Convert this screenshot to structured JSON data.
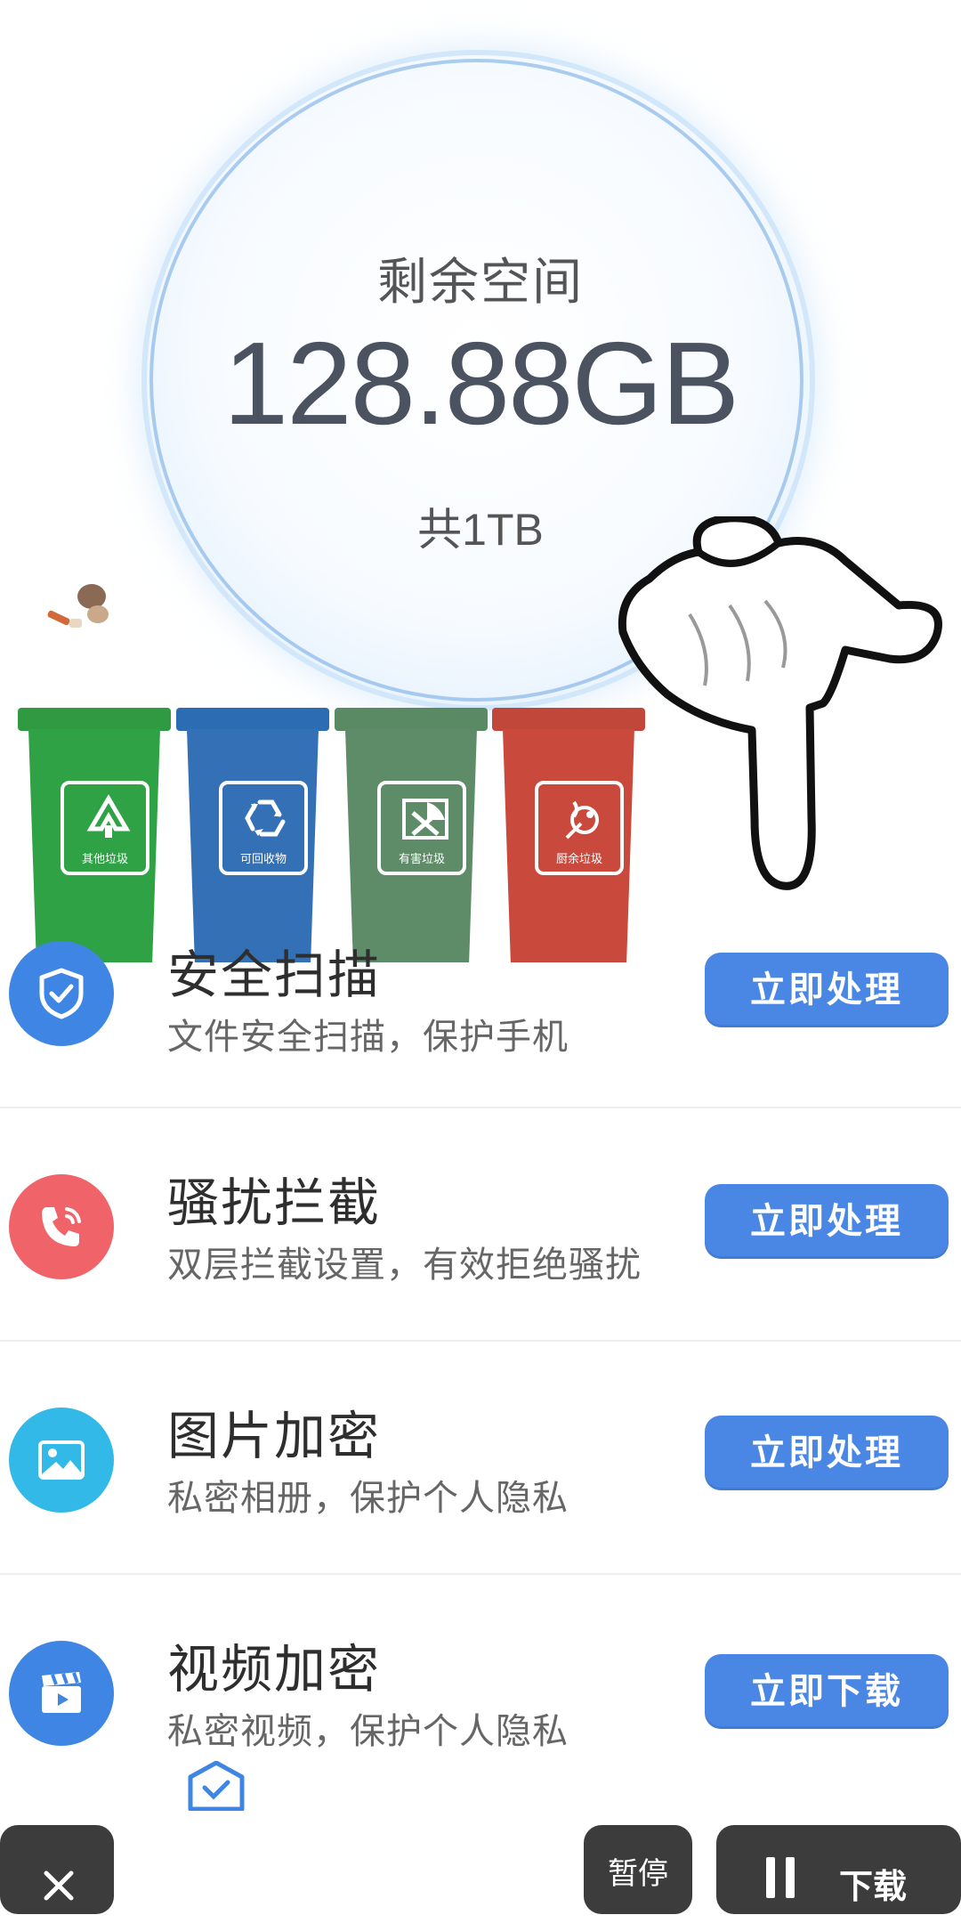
{
  "storage": {
    "label": "剩余空间",
    "value": "128.88GB",
    "total": "共1TB"
  },
  "bins": [
    {
      "label": "其他垃圾",
      "color": "#2e9e43"
    },
    {
      "label": "可回收物",
      "color": "#2f6fb5"
    },
    {
      "label": "有害垃圾",
      "color": "#5a8a64"
    },
    {
      "label": "厨余垃圾",
      "color": "#c8493c"
    }
  ],
  "features": [
    {
      "title": "安全扫描",
      "desc": "文件安全扫描，保护手机",
      "button": "立即处理",
      "icon": "shield-check-icon",
      "color": "#3f86e4"
    },
    {
      "title": "骚扰拦截",
      "desc": "双层拦截设置，有效拒绝骚扰",
      "button": "立即处理",
      "icon": "phone-call-icon",
      "color": "#f06368"
    },
    {
      "title": "图片加密",
      "desc": "私密相册，保护个人隐私",
      "button": "立即处理",
      "icon": "image-icon",
      "color": "#33b9e8"
    },
    {
      "title": "视频加密",
      "desc": "私密视频，保护个人隐私",
      "button": "立即下载",
      "icon": "video-clapper-icon",
      "color": "#3f86e4"
    }
  ],
  "bottom_bar": {
    "close_icon": "close-icon",
    "pause_label": "暂停",
    "download_label": "下载"
  }
}
